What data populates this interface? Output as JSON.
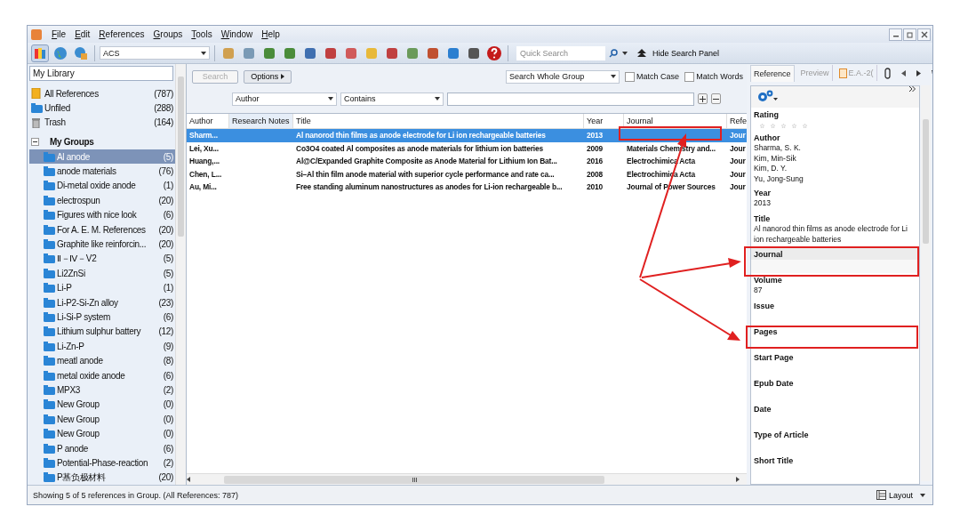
{
  "menu": [
    "File",
    "Edit",
    "References",
    "Groups",
    "Tools",
    "Window",
    "Help"
  ],
  "toolbar": {
    "style_field": "ACS",
    "quick_search": {
      "placeholder": "Quick Search"
    },
    "hide_panel": "Hide Search Panel"
  },
  "sidebar": {
    "header": "My Library",
    "items": [
      {
        "label": "All References",
        "count": "(787)",
        "kind": "all"
      },
      {
        "label": "Unfiled",
        "count": "(288)",
        "kind": "folder"
      },
      {
        "label": "Trash",
        "count": "(164)",
        "kind": "trash"
      }
    ],
    "groups": {
      "label": "My Groups",
      "expanded": true,
      "children": [
        {
          "label": "Al anode",
          "count": "(5)",
          "selected": true
        },
        {
          "label": "anode materials",
          "count": "(76)",
          "selected": false
        },
        {
          "label": "Di-metal oxide anode",
          "count": "(1)",
          "selected": false
        },
        {
          "label": "electrospun",
          "count": "(20)",
          "selected": false
        },
        {
          "label": "Figures with nice look",
          "count": "(6)",
          "selected": false
        },
        {
          "label": "For A. E. M. References",
          "count": "(20)",
          "selected": false
        },
        {
          "label": "Graphite like reinforcin...",
          "count": "(20)",
          "selected": false
        },
        {
          "label": "Ⅱ－Ⅳ－V2",
          "count": "(5)",
          "selected": false
        },
        {
          "label": "Li2ZnSi",
          "count": "(5)",
          "selected": false
        },
        {
          "label": "Li-P",
          "count": "(1)",
          "selected": false
        },
        {
          "label": "Li-P2-Si-Zn alloy",
          "count": "(23)",
          "selected": false
        },
        {
          "label": "Li-Si-P system",
          "count": "(6)",
          "selected": false
        },
        {
          "label": "Lithium sulphur battery",
          "count": "(12)",
          "selected": false
        },
        {
          "label": "Li-Zn-P",
          "count": "(9)",
          "selected": false
        },
        {
          "label": "meatl anode",
          "count": "(8)",
          "selected": false
        },
        {
          "label": "metal oxide anode",
          "count": "(6)",
          "selected": false
        },
        {
          "label": "MPX3",
          "count": "(2)",
          "selected": false
        },
        {
          "label": "New Group",
          "count": "(0)",
          "selected": false
        },
        {
          "label": "New Group",
          "count": "(0)",
          "selected": false
        },
        {
          "label": "New Group",
          "count": "(0)",
          "selected": false
        },
        {
          "label": "P anode",
          "count": "(6)",
          "selected": false
        },
        {
          "label": "Potential-Phase-reaction",
          "count": "(2)",
          "selected": false
        },
        {
          "label": "P基负极材料",
          "count": "(20)",
          "selected": false
        }
      ]
    }
  },
  "search_panel": {
    "search_button": {
      "label": "Search",
      "disabled": true
    },
    "options_button": "Options",
    "scope": "Search Whole Group",
    "checkboxes": [
      {
        "label": "Match Case",
        "checked": false
      },
      {
        "label": "Match Words",
        "checked": false
      }
    ],
    "field": "Author",
    "operator": "Contains"
  },
  "table": {
    "columns": [
      "Author",
      "Research Notes",
      "Title",
      "Year",
      "Journal",
      "Refe"
    ],
    "rows": [
      {
        "cells": [
          "Sharm...",
          "",
          "Al nanorod thin films as anode electrode for Li ion rechargeable batteries",
          "2013",
          "",
          "Jour"
        ],
        "selected": true
      },
      {
        "cells": [
          "Lei, Xu...",
          "",
          "Co3O4 coated Al composites as anode materials for lithium ion batteries",
          "2009",
          "Materials Chemistry and...",
          "Jour"
        ],
        "selected": false
      },
      {
        "cells": [
          "Huang,...",
          "",
          "Al@C/Expanded Graphite Composite as Anode Material for Lithium Ion Bat...",
          "2016",
          "Electrochimica Acta",
          "Jour"
        ],
        "selected": false
      },
      {
        "cells": [
          "Chen, L...",
          "",
          "Si–Al thin film anode material with superior cycle performance and rate ca...",
          "2008",
          "Electrochimica Acta",
          "Jour"
        ],
        "selected": false
      },
      {
        "cells": [
          "Au, Mi...",
          "",
          "Free standing aluminum nanostructures as anodes for Li-ion rechargeable b...",
          "2010",
          "Journal of Power Sources",
          "Jour"
        ],
        "selected": false
      }
    ]
  },
  "reference_panel": {
    "tabs": [
      {
        "label": "Reference",
        "selected": true
      },
      {
        "label": "Preview",
        "selected": false
      },
      {
        "label": "E.A.-2(",
        "selected": false
      }
    ],
    "fields": [
      {
        "label": "Rating",
        "stars": 0
      },
      {
        "label": "Author",
        "lines": [
          "Sharma, S. K.",
          "Kim, Min-Sik",
          "Kim, D. Y.",
          "Yu, Jong-Sung"
        ],
        "selected": false
      },
      {
        "label": "Year",
        "lines": [
          "2013"
        ],
        "selected": false
      },
      {
        "label": "Title",
        "lines": [
          "Al nanorod thin films as anode electrode for Li ion rechargeable batteries"
        ],
        "selected": false
      },
      {
        "label": "Journal",
        "selected": true
      },
      {
        "label": "Volume",
        "lines": [
          "87"
        ],
        "selected": false
      },
      {
        "label": "Issue",
        "selected": false
      },
      {
        "label": "Pages",
        "selected": false
      },
      {
        "label": "Start Page",
        "selected": false
      },
      {
        "label": "Epub Date",
        "selected": false
      },
      {
        "label": "Date",
        "selected": false
      },
      {
        "label": "Type of Article",
        "selected": false
      },
      {
        "label": "Short Title",
        "selected": false
      }
    ]
  },
  "status_bar": {
    "text": "Showing 5 of 5 references in Group. (All References: 787)",
    "layout_button": "Layout"
  }
}
